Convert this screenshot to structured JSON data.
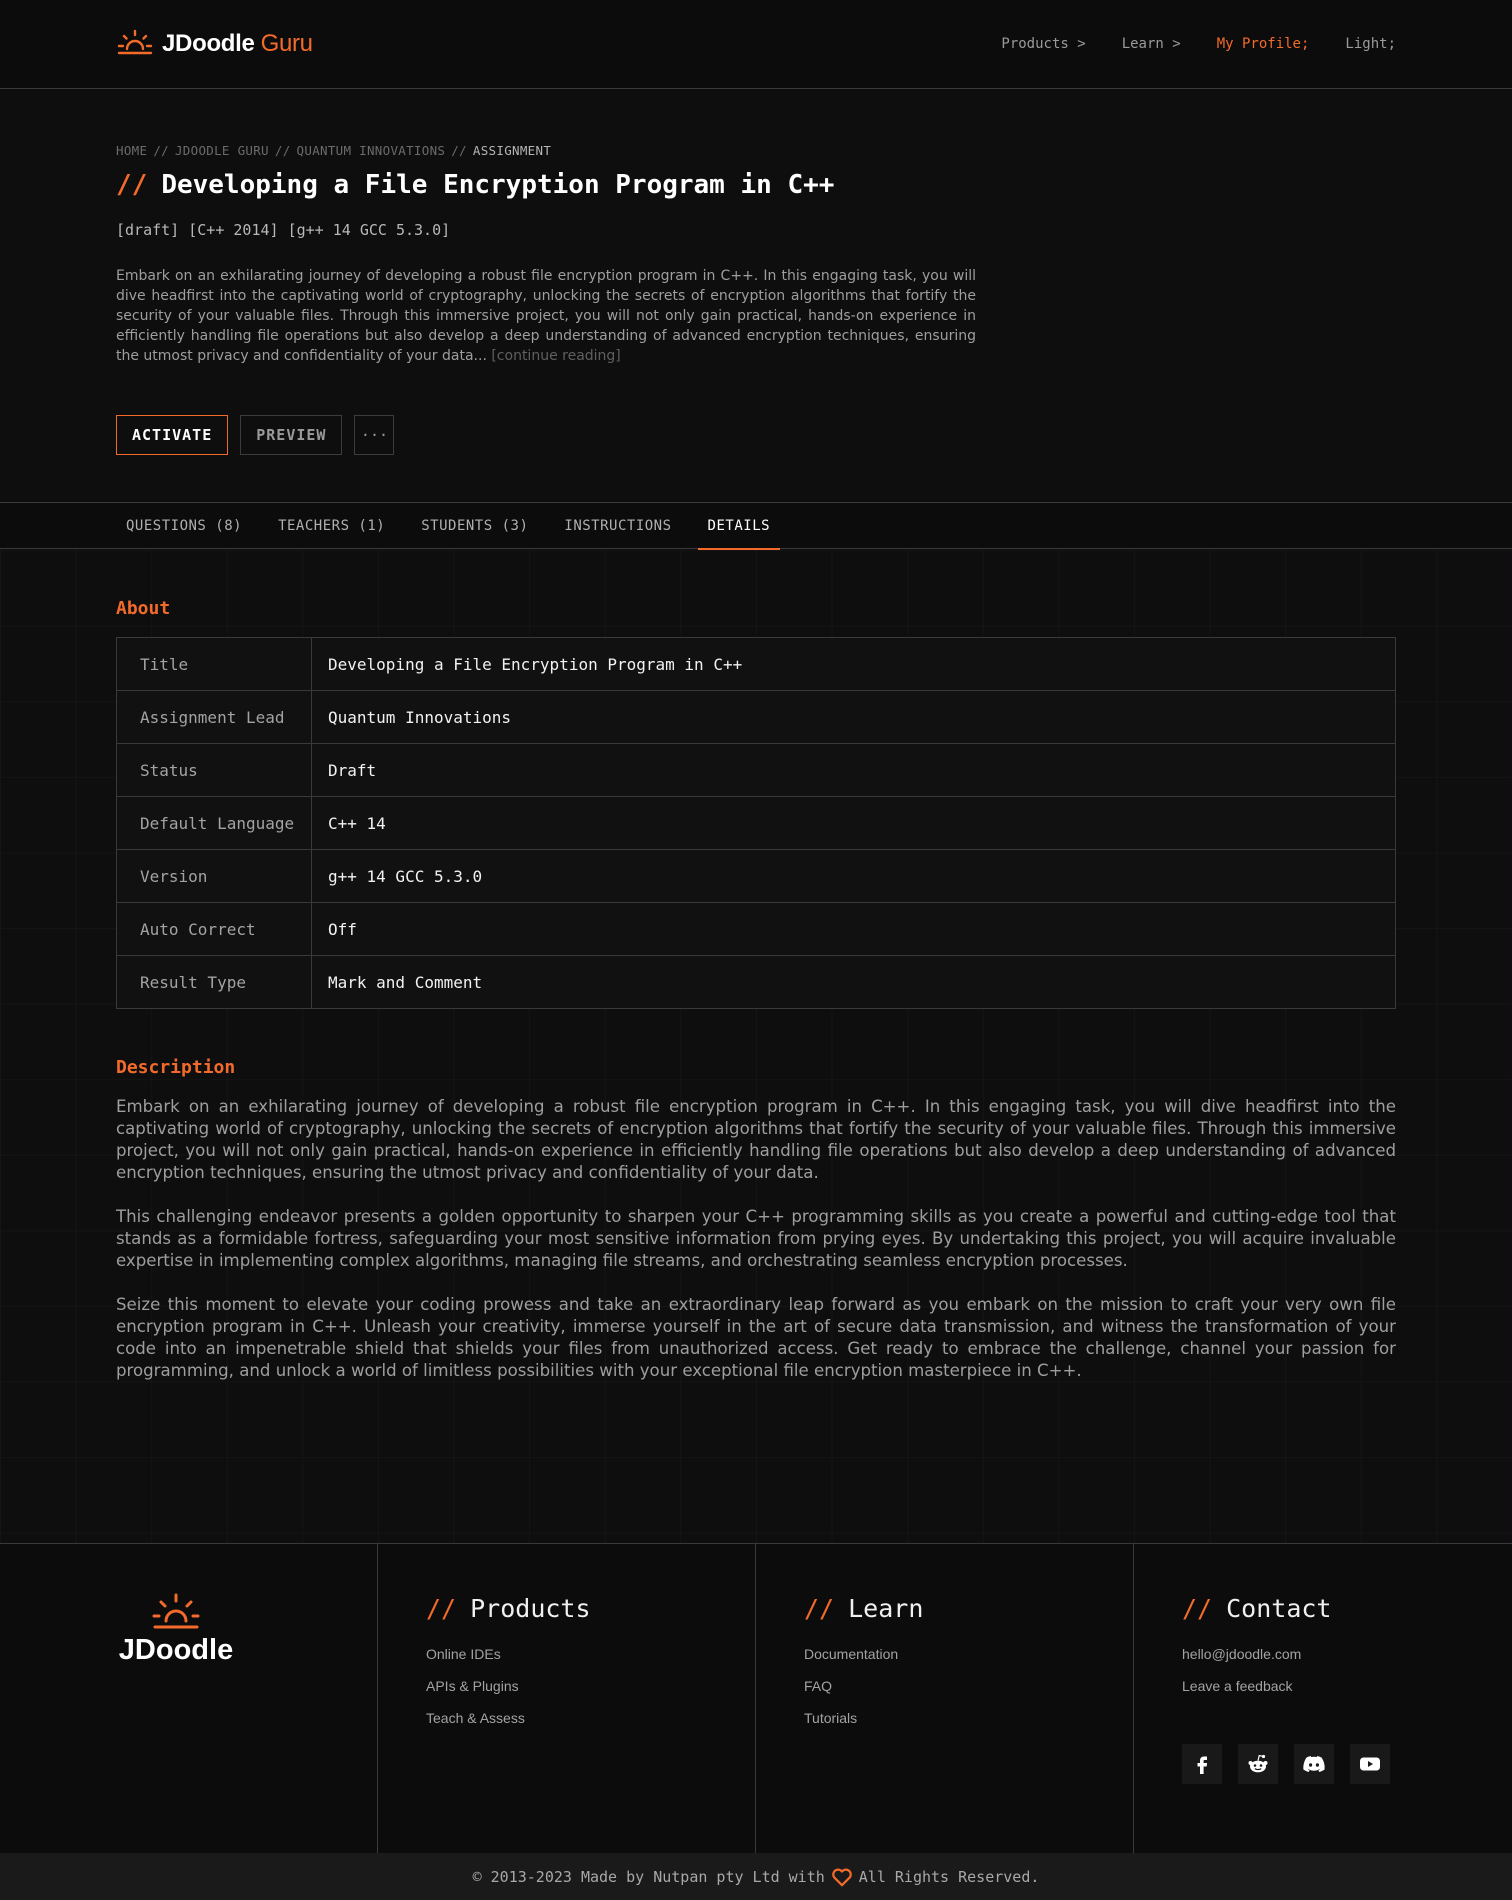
{
  "header": {
    "logo_text": "JDoodle",
    "logo_suffix": "Guru",
    "nav": [
      {
        "label": "Products >"
      },
      {
        "label": "Learn >"
      },
      {
        "label": "My Profile;"
      },
      {
        "label": "Light;"
      }
    ]
  },
  "breadcrumb": {
    "items": [
      "HOME",
      "JDOODLE GURU",
      "QUANTUM INNOVATIONS",
      "ASSIGNMENT"
    ],
    "separator": "//"
  },
  "hero": {
    "title_prefix": "//",
    "title": "Developing a File Encryption Program in C++",
    "tags": "[draft] [C++ 2014] [g++ 14 GCC 5.3.0]",
    "summary": "Embark on an exhilarating journey of developing a robust file encryption program in C++. In this engaging task, you will dive headfirst into the captivating world of cryptography, unlocking the secrets of encryption algorithms that fortify the security of your valuable files. Through this immersive project, you will not only gain practical, hands-on experience in efficiently handling file operations but also develop a deep understanding of advanced encryption techniques, ensuring the utmost privacy and confidentiality of your data...",
    "continue_label": "[continue reading]",
    "buttons": {
      "activate": "ACTIVATE",
      "preview": "PREVIEW",
      "more": "···"
    }
  },
  "tabs": [
    {
      "label": "QUESTIONS (8)"
    },
    {
      "label": "TEACHERS (1)"
    },
    {
      "label": "STUDENTS (3)"
    },
    {
      "label": "INSTRUCTIONS"
    },
    {
      "label": "DETAILS"
    }
  ],
  "about": {
    "heading": "About",
    "rows": [
      {
        "key": "Title",
        "value": "Developing a File Encryption Program in C++"
      },
      {
        "key": "Assignment Lead",
        "value": "Quantum Innovations"
      },
      {
        "key": "Status",
        "value": "Draft"
      },
      {
        "key": "Default Language",
        "value": "C++ 14"
      },
      {
        "key": "Version",
        "value": "g++ 14 GCC 5.3.0"
      },
      {
        "key": "Auto Correct",
        "value": "Off"
      },
      {
        "key": "Result Type",
        "value": "Mark and Comment"
      }
    ]
  },
  "description": {
    "heading": "Description",
    "paragraphs": [
      "Embark on an exhilarating journey of developing a robust file encryption program in C++. In this engaging task, you will dive headfirst into the captivating world of cryptography, unlocking the secrets of encryption algorithms that fortify the security of your valuable files. Through this immersive project, you will not only gain practical, hands-on experience in efficiently handling file operations but also develop a deep understanding of advanced encryption techniques, ensuring the utmost privacy and confidentiality of your data.",
      "This challenging endeavor presents a golden opportunity to sharpen your C++ programming skills as you create a powerful and cutting-edge tool that stands as a formidable fortress, safeguarding your most sensitive information from prying eyes. By undertaking this project, you will acquire invaluable expertise in implementing complex algorithms, managing file streams, and orchestrating seamless encryption processes.",
      "Seize this moment to elevate your coding prowess and take an extraordinary leap forward as you embark on the mission to craft your very own file encryption program in C++. Unleash your creativity, immerse yourself in the art of secure data transmission, and witness the transformation of your code into an impenetrable shield that shields your files from unauthorized access. Get ready to embrace the challenge, channel your passion for programming, and unlock a world of limitless possibilities with your exceptional file encryption masterpiece in C++."
    ]
  },
  "footer": {
    "logo_text": "JDoodle",
    "products": {
      "heading": "Products",
      "links": [
        "Online IDEs",
        "APIs & Plugins",
        "Teach & Assess"
      ]
    },
    "learn": {
      "heading": "Learn",
      "links": [
        "Documentation",
        "FAQ",
        "Tutorials"
      ]
    },
    "contact": {
      "heading": "Contact",
      "links": [
        "hello@jdoodle.com",
        "Leave a feedback"
      ]
    },
    "social_icons": [
      "facebook-icon",
      "reddit-icon",
      "discord-icon",
      "youtube-icon"
    ],
    "copyright_left": "© 2013-2023 Made by Nutpan pty Ltd with",
    "copyright_right": "All Rights Reserved."
  },
  "colors": {
    "accent": "#f26b2a",
    "background": "#0f0e0f",
    "border": "#3a3a3a"
  }
}
